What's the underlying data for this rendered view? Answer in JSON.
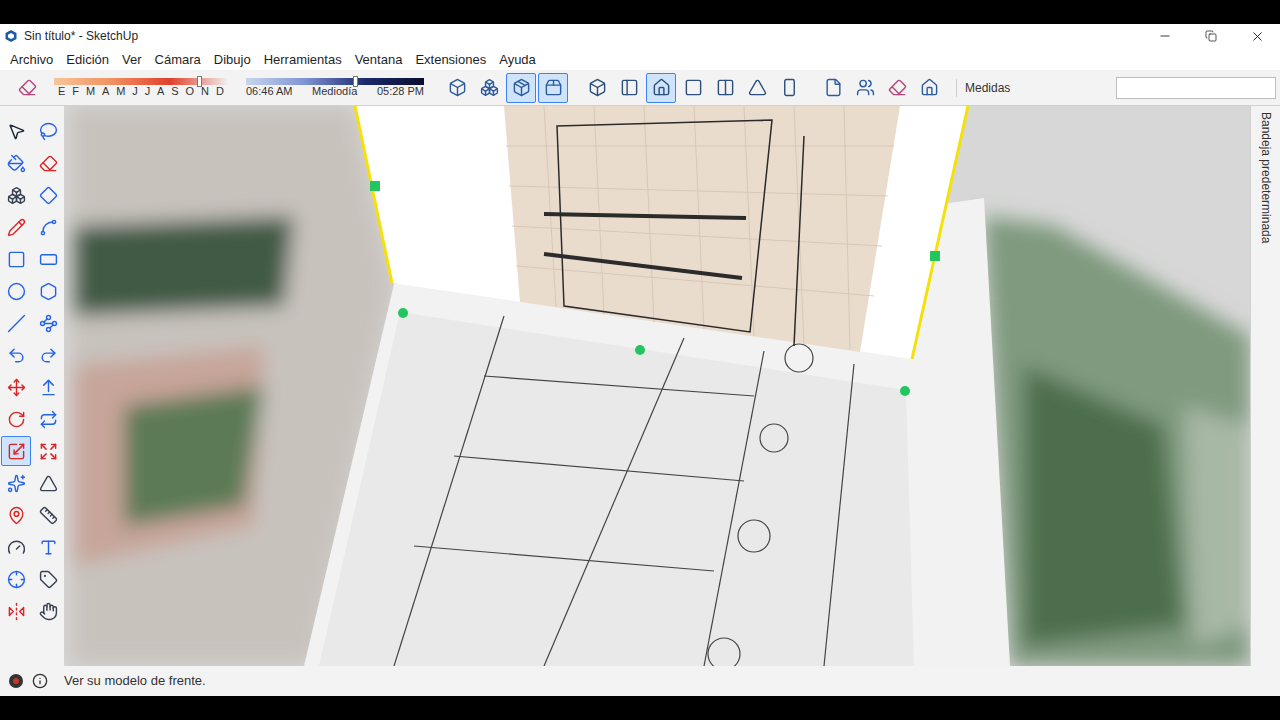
{
  "window": {
    "title": "Sin título* - SketchUp"
  },
  "menu": [
    "Archivo",
    "Edición",
    "Ver",
    "Cámara",
    "Dibujo",
    "Herramientas",
    "Ventana",
    "Extensiones",
    "Ayuda"
  ],
  "toolbar": {
    "first_button": {
      "selected": false
    },
    "shadow": {
      "months": [
        "E",
        "F",
        "M",
        "A",
        "M",
        "J",
        "J",
        "A",
        "S",
        "O",
        "N",
        "D"
      ],
      "month_level": 0.84,
      "time_start": "06:46 AM",
      "time_mid": "Mediodía",
      "time_end": "05:28 PM",
      "time_level": 0.62
    },
    "style_buttons": [
      {
        "selected": false
      },
      {
        "selected": false
      },
      {
        "selected": true
      },
      {
        "selected": true
      }
    ],
    "view_buttons": [
      {
        "selected": false
      },
      {
        "selected": false
      },
      {
        "selected": true
      },
      {
        "selected": false
      },
      {
        "selected": false
      },
      {
        "selected": false
      },
      {
        "selected": false
      }
    ],
    "extra_buttons": [
      {
        "selected": false
      },
      {
        "selected": false
      },
      {
        "selected": false
      },
      {
        "selected": false
      }
    ],
    "measurements": {
      "label": "Medidas",
      "value": ""
    }
  },
  "tools": [
    {
      "selected": false
    },
    {
      "selected": false
    },
    {
      "selected": false
    },
    {
      "selected": false
    },
    {
      "selected": false
    },
    {
      "selected": false
    },
    {
      "selected": false
    },
    {
      "selected": false
    },
    {
      "selected": false
    },
    {
      "selected": false
    },
    {
      "selected": false
    },
    {
      "selected": false
    },
    {
      "selected": false
    },
    {
      "selected": false
    },
    {
      "selected": false
    },
    {
      "selected": false
    },
    {
      "selected": false
    },
    {
      "selected": false
    },
    {
      "selected": false
    },
    {
      "selected": false
    },
    {
      "selected": true
    },
    {
      "selected": false
    },
    {
      "selected": false
    },
    {
      "selected": false
    },
    {
      "selected": false
    },
    {
      "selected": false
    },
    {
      "selected": false
    },
    {
      "selected": false
    },
    {
      "selected": false
    },
    {
      "selected": false
    },
    {
      "selected": false
    },
    {
      "selected": false
    }
  ],
  "tray": {
    "title": "Bandeja predeterminada"
  },
  "status_bar": {
    "text": "Ver su modelo de frente."
  }
}
